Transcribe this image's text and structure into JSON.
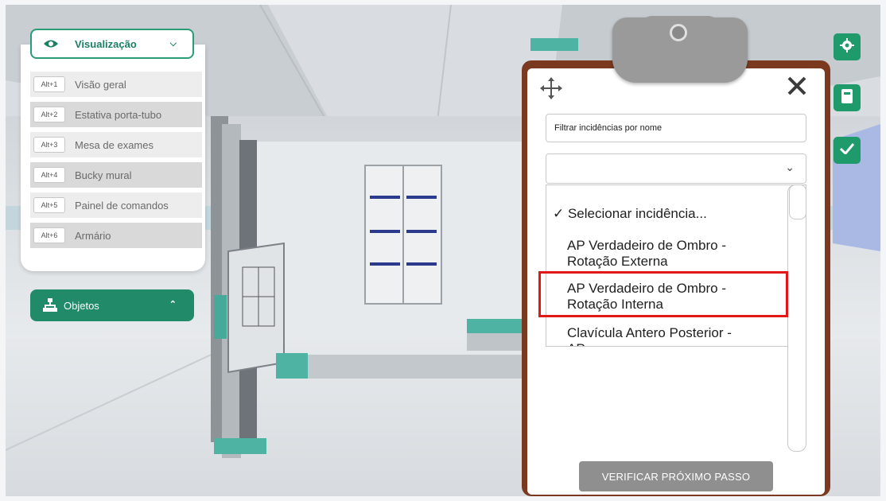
{
  "view_menu": {
    "title": "Visualização",
    "items": [
      {
        "key": "Alt+1",
        "label": "Visão geral"
      },
      {
        "key": "Alt+2",
        "label": "Estativa porta-tubo"
      },
      {
        "key": "Alt+3",
        "label": "Mesa de exames"
      },
      {
        "key": "Alt+4",
        "label": "Bucky mural"
      },
      {
        "key": "Alt+5",
        "label": "Painel de comandos"
      },
      {
        "key": "Alt+6",
        "label": "Armário"
      }
    ]
  },
  "objects_button": {
    "label": "Objetos"
  },
  "clipboard": {
    "filter_placeholder": "Filtrar incidências por nome",
    "dropdown_value": "",
    "options": [
      {
        "label": "✓ Selecionar incidência..."
      },
      {
        "label": "AP Verdadeiro de Ombro -",
        "label2": "Rotação Externa"
      },
      {
        "label": "AP Verdadeiro de Ombro -",
        "label2": "Rotação Interna"
      },
      {
        "label": "Clavícula Antero Posterior -",
        "label2": "AP"
      }
    ],
    "verify_button": "VERIFICAR PRÓXIMO PASSO"
  },
  "icons": {
    "move": "move-icon",
    "close": "close-icon",
    "settings": "gear-icon",
    "notes": "notepad-icon",
    "check": "check-icon"
  },
  "colors": {
    "accent": "#1f9a6a",
    "clipboard_frame": "#7b3a1f",
    "highlight": "#e01818"
  }
}
